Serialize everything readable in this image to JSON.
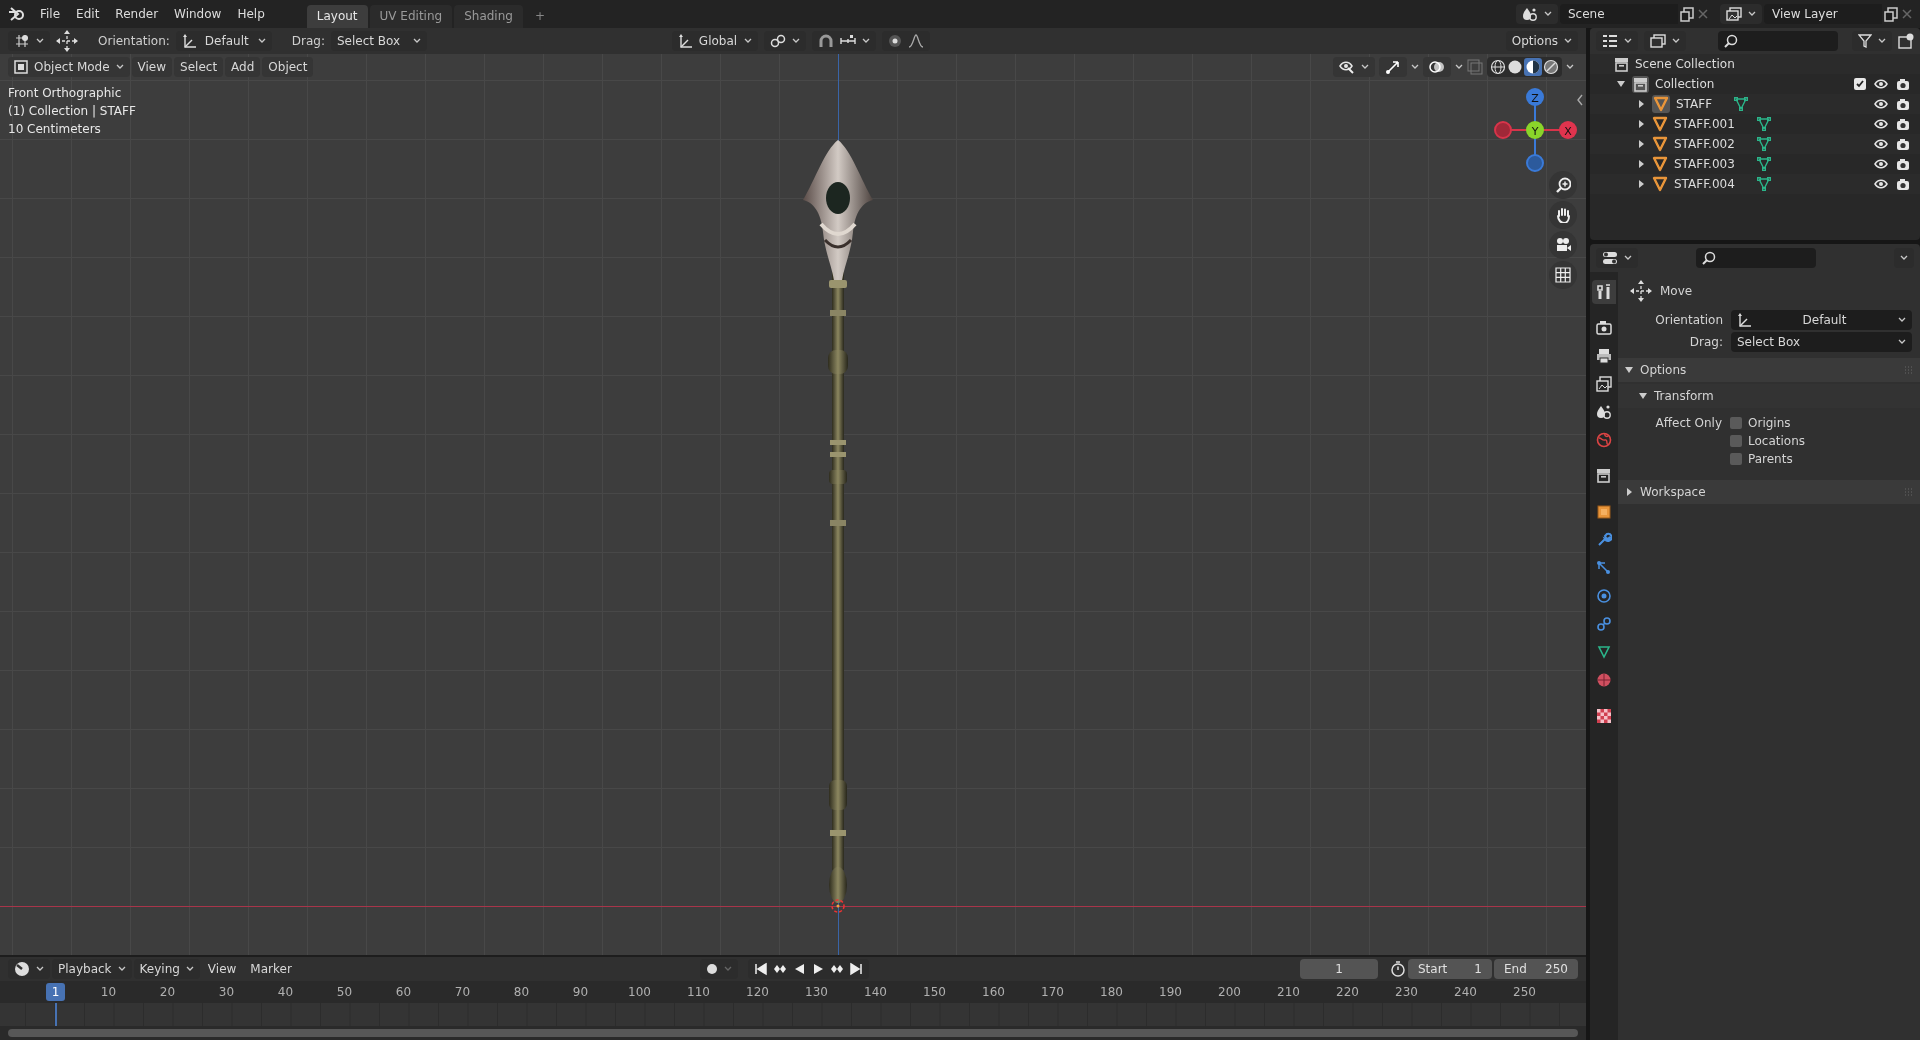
{
  "menu_bar": {
    "menus": [
      "File",
      "Edit",
      "Render",
      "Window",
      "Help"
    ],
    "workspaces": [
      {
        "label": "Layout",
        "selected": true
      },
      {
        "label": "UV Editing",
        "selected": false
      },
      {
        "label": "Shading",
        "selected": false
      }
    ],
    "add_workspace": "+",
    "scene": "Scene",
    "view_layer": "View Layer"
  },
  "tool_settings": {
    "orientation_label": "Orientation:",
    "orientation": "Default",
    "drag_label": "Drag:",
    "drag": "Select Box",
    "transform_orientation": "Global",
    "options": "Options"
  },
  "viewport": {
    "mode": "Object Mode",
    "menus": [
      "View",
      "Select",
      "Add",
      "Object"
    ],
    "info": [
      "Front Orthographic",
      "(1) Collection | STAFF",
      "10 Centimeters"
    ],
    "gizmo": {
      "z": "Z",
      "y": "Y",
      "x": "X"
    }
  },
  "outliner": {
    "root": "Scene Collection",
    "collections": [
      {
        "name": "Collection",
        "expanded": true,
        "checked": true,
        "children": [
          {
            "name": "STAFF",
            "expanded": false,
            "selected": true
          },
          {
            "name": "STAFF.001",
            "expanded": false,
            "selected": false
          },
          {
            "name": "STAFF.002",
            "expanded": false,
            "selected": false
          },
          {
            "name": "STAFF.003",
            "expanded": false,
            "selected": false
          },
          {
            "name": "STAFF.004",
            "expanded": false,
            "selected": false
          }
        ]
      }
    ]
  },
  "properties": {
    "tabs": [
      {
        "kind": "tool",
        "selected": true
      },
      {
        "kind": "render",
        "selected": false
      },
      {
        "kind": "output",
        "selected": false
      },
      {
        "kind": "view_layer",
        "selected": false
      },
      {
        "kind": "scene",
        "selected": false
      },
      {
        "kind": "world",
        "selected": false
      },
      {
        "kind": "collection",
        "selected": false
      },
      {
        "kind": "object",
        "selected": false
      },
      {
        "kind": "modifiers",
        "selected": false
      },
      {
        "kind": "particles",
        "selected": false
      },
      {
        "kind": "physics",
        "selected": false
      },
      {
        "kind": "constraints",
        "selected": false
      },
      {
        "kind": "data",
        "selected": false
      },
      {
        "kind": "material",
        "selected": false
      },
      {
        "kind": "texture",
        "selected": false
      }
    ],
    "tool": {
      "name": "Move",
      "orientation_label": "Orientation",
      "orientation": "Default",
      "drag_label": "Drag:",
      "drag": "Select Box"
    },
    "panels": [
      {
        "title": "Options",
        "expanded": true,
        "children": [
          {
            "title": "Transform",
            "expanded": true,
            "label": "Affect Only",
            "options": [
              {
                "label": "Origins",
                "checked": false
              },
              {
                "label": "Locations",
                "checked": false
              },
              {
                "label": "Parents",
                "checked": false
              }
            ]
          }
        ]
      },
      {
        "title": "Workspace",
        "expanded": false
      }
    ]
  },
  "timeline": {
    "menus": [
      {
        "label": "Playback",
        "kind": "dropdown"
      },
      {
        "label": "Keying",
        "kind": "dropdown"
      },
      {
        "label": "View",
        "kind": "menu"
      },
      {
        "label": "Marker",
        "kind": "menu"
      }
    ],
    "current_frame": "1",
    "start_label": "Start",
    "start": "1",
    "end_label": "End",
    "end": "250",
    "playhead": "1",
    "ruler": [
      "10",
      "20",
      "30",
      "40",
      "50",
      "60",
      "70",
      "80",
      "90",
      "100",
      "110",
      "120",
      "130",
      "140",
      "150",
      "160",
      "170",
      "180",
      "190",
      "200",
      "210",
      "220",
      "230",
      "240",
      "250"
    ]
  }
}
